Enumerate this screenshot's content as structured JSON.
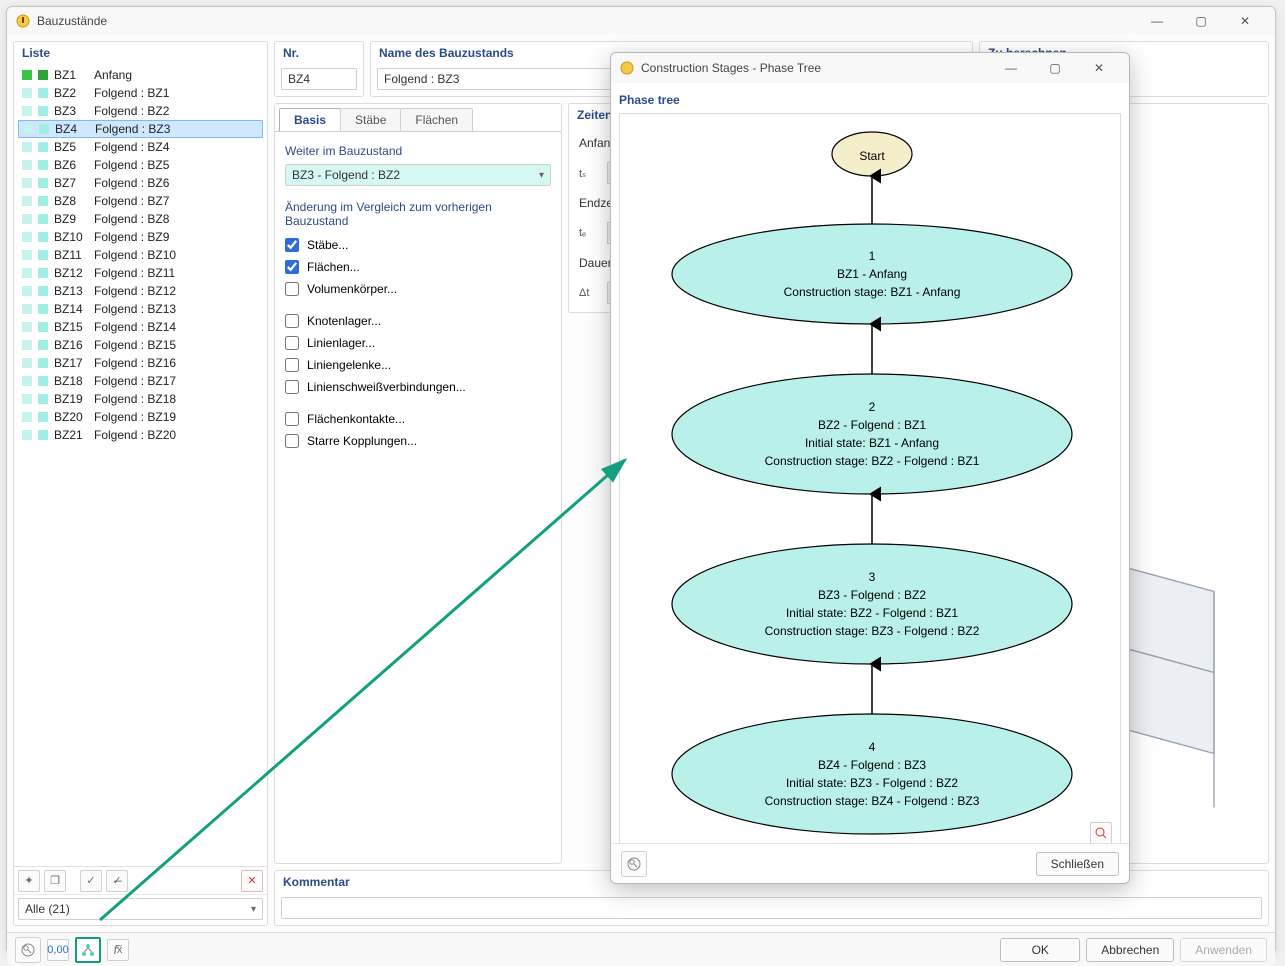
{
  "main_window": {
    "title": "Bauzustände"
  },
  "sidebar": {
    "heading": "Liste",
    "items": [
      {
        "id": "BZ1",
        "desc": "Anfang",
        "green": true
      },
      {
        "id": "BZ2",
        "desc": "Folgend : BZ1"
      },
      {
        "id": "BZ3",
        "desc": "Folgend : BZ2"
      },
      {
        "id": "BZ4",
        "desc": "Folgend : BZ3",
        "selected": true
      },
      {
        "id": "BZ5",
        "desc": "Folgend : BZ4"
      },
      {
        "id": "BZ6",
        "desc": "Folgend : BZ5"
      },
      {
        "id": "BZ7",
        "desc": "Folgend : BZ6"
      },
      {
        "id": "BZ8",
        "desc": "Folgend : BZ7"
      },
      {
        "id": "BZ9",
        "desc": "Folgend : BZ8"
      },
      {
        "id": "BZ10",
        "desc": "Folgend : BZ9"
      },
      {
        "id": "BZ11",
        "desc": "Folgend : BZ10"
      },
      {
        "id": "BZ12",
        "desc": "Folgend : BZ11"
      },
      {
        "id": "BZ13",
        "desc": "Folgend : BZ12"
      },
      {
        "id": "BZ14",
        "desc": "Folgend : BZ13"
      },
      {
        "id": "BZ15",
        "desc": "Folgend : BZ14"
      },
      {
        "id": "BZ16",
        "desc": "Folgend : BZ15"
      },
      {
        "id": "BZ17",
        "desc": "Folgend : BZ16"
      },
      {
        "id": "BZ18",
        "desc": "Folgend : BZ17"
      },
      {
        "id": "BZ19",
        "desc": "Folgend : BZ18"
      },
      {
        "id": "BZ20",
        "desc": "Folgend : BZ19"
      },
      {
        "id": "BZ21",
        "desc": "Folgend : BZ20"
      }
    ],
    "filter_label": "Alle (21)"
  },
  "header_fields": {
    "nr_label": "Nr.",
    "nr_value": "BZ4",
    "name_label": "Name des Bauzustands",
    "name_value": "Folgend : BZ3",
    "zu_label": "Zu berechnen"
  },
  "tabs": {
    "basis": "Basis",
    "staebe": "Stäbe",
    "flaechen": "Flächen"
  },
  "basis": {
    "weiter_h": "Weiter im Bauzustand",
    "weiter_value": "BZ3 - Folgend : BZ2",
    "aenderung_h": "Änderung im Vergleich zum vorherigen Bauzustand",
    "cb_staebe": "Stäbe...",
    "cb_flaechen": "Flächen...",
    "cb_volumen": "Volumenkörper...",
    "cb_knoten": "Knotenlager...",
    "cb_linien": "Linienlager...",
    "cb_gelenke": "Liniengelenke...",
    "cb_schweiss": "Linienschweißverbindungen...",
    "cb_kontakte": "Flächenkontakte...",
    "cb_kopplungen": "Starre Kopplungen..."
  },
  "zeit": {
    "heading": "Zeiten",
    "anfang": "Anfang",
    "ts": "tₛ",
    "ende": "Endzeit",
    "te": "tₑ",
    "dauer": "Dauer",
    "dt": "Δt"
  },
  "kommentar_h": "Kommentar",
  "buttons": {
    "ok": "OK",
    "abbrechen": "Abbrechen",
    "anwenden": "Anwenden"
  },
  "phase_window": {
    "title": "Construction Stages - Phase Tree",
    "heading": "Phase tree",
    "close_btn": "Schließen"
  },
  "chart_data": {
    "type": "diagram",
    "title": "Phase tree",
    "start_label": "Start",
    "nodes": [
      {
        "num": "1",
        "line1": "BZ1 - Anfang",
        "line2": "",
        "line3": "Construction stage: BZ1 - Anfang"
      },
      {
        "num": "2",
        "line1": "BZ2 - Folgend : BZ1",
        "line2": "Initial state: BZ1 - Anfang",
        "line3": "Construction stage: BZ2 - Folgend : BZ1"
      },
      {
        "num": "3",
        "line1": "BZ3 - Folgend : BZ2",
        "line2": "Initial state: BZ2 - Folgend : BZ1",
        "line3": "Construction stage: BZ3 - Folgend : BZ2"
      },
      {
        "num": "4",
        "line1": "BZ4 - Folgend : BZ3",
        "line2": "Initial state: BZ3 - Folgend : BZ2",
        "line3": "Construction stage: BZ4 - Folgend : BZ3"
      }
    ]
  },
  "colors": {
    "accent_teal": "#149e80",
    "node_fill": "#b9f0ea",
    "start_fill": "#f5eecb"
  }
}
